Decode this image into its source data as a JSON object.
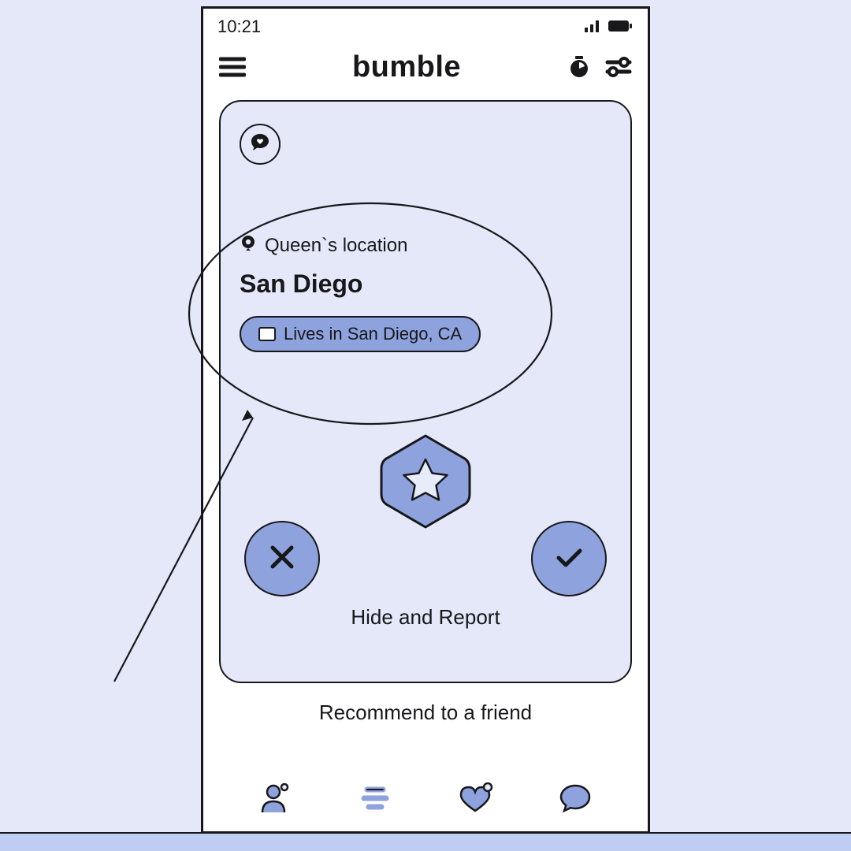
{
  "status_bar": {
    "time": "10:21"
  },
  "header": {
    "title": "bumble"
  },
  "profile": {
    "location_label": "Queen`s location",
    "city": "San Diego",
    "lives_in_chip": "Lives in San Diego, CA",
    "hide_report_label": "Hide and Report"
  },
  "recommend_label": "Recommend to a friend",
  "colors": {
    "accent": "#8ea2dd",
    "bg": "#e4e8f9",
    "ink": "#18181b"
  }
}
